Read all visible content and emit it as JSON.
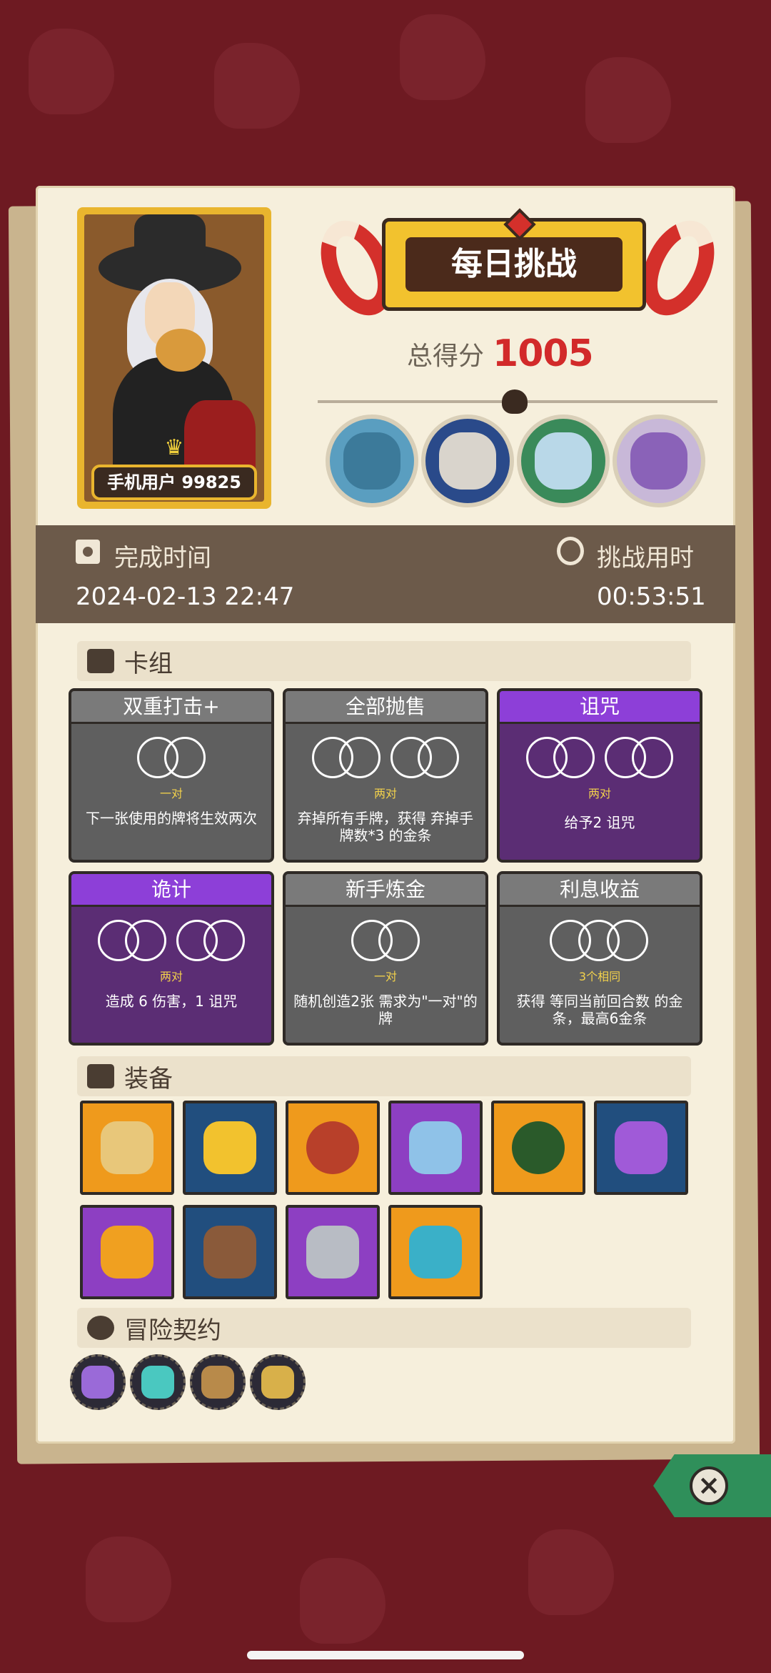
{
  "player": {
    "name": "手机用户 99825"
  },
  "challenge": {
    "title": "每日挑战",
    "score_label": "总得分",
    "score_value": "1005"
  },
  "bosses": [
    {
      "icon": "blue-ogre-boss-icon",
      "color": "#5a9ec0"
    },
    {
      "icon": "masked-woman-boss-icon",
      "color": "#d9d4cc"
    },
    {
      "icon": "hooded-child-boss-icon",
      "color": "#b9d8e8"
    },
    {
      "icon": "purple-dragon-boss-icon",
      "color": "#8a62b8"
    }
  ],
  "time": {
    "finish_label": "完成时间",
    "finish_value": "2024-02-13  22:47",
    "duration_label": "挑战用时",
    "duration_value": "00:53:51"
  },
  "sections": {
    "deck": "卡组",
    "equipment": "装备",
    "contracts": "冒险契约"
  },
  "cards": [
    {
      "title": "双重打击+",
      "color": "gray",
      "rings": "pair",
      "req": "一对",
      "desc": "下一张使用的牌将生效两次"
    },
    {
      "title": "全部抛售",
      "color": "gray",
      "rings": "two-pair",
      "req": "两对",
      "desc": "弃掉所有手牌，获得 弃掉手牌数*3 的金条"
    },
    {
      "title": "诅咒",
      "color": "purple",
      "rings": "two-pair",
      "req": "两对",
      "desc": "给予2 诅咒"
    },
    {
      "title": "诡计",
      "color": "purple",
      "rings": "two-pair",
      "req": "两对",
      "desc": "造成 6 伤害，1 诅咒"
    },
    {
      "title": "新手炼金",
      "color": "gray",
      "rings": "pair",
      "req": "一对",
      "desc": "随机创造2张 需求为\"一对\"的牌"
    },
    {
      "title": "利息收益",
      "color": "gray",
      "rings": "triple",
      "req": "3个相同",
      "desc": "获得 等同当前回合数 的金条，最高6金条"
    }
  ],
  "equipment": [
    {
      "icon": "money-sack-icon",
      "bg": "orange",
      "fill": "#e8c77a"
    },
    {
      "icon": "golden-helmet-icon",
      "bg": "blue",
      "fill": "#f2c22e"
    },
    {
      "icon": "red-plate-icon",
      "bg": "orange",
      "fill": "#b8402a"
    },
    {
      "icon": "blue-dagger-icon",
      "bg": "violet",
      "fill": "#8fc2e8"
    },
    {
      "icon": "green-horn-icon",
      "bg": "orange",
      "fill": "#2a5a2a"
    },
    {
      "icon": "purple-potion-icon",
      "bg": "blue",
      "fill": "#a05ad8"
    },
    {
      "icon": "fire-gauntlet-icon",
      "bg": "violet",
      "fill": "#f0a020"
    },
    {
      "icon": "horn-cup-icon",
      "bg": "blue",
      "fill": "#8a5a3a"
    },
    {
      "icon": "metal-cube-icon",
      "bg": "violet",
      "fill": "#b8bcc4"
    },
    {
      "icon": "flame-mask-icon",
      "bg": "orange",
      "fill": "#3ab0c8"
    }
  ],
  "contracts": [
    {
      "icon": "skull-claw-contract-icon",
      "fill": "#9a6ad8"
    },
    {
      "icon": "eye-coin-contract-icon",
      "fill": "#4ac8c0"
    },
    {
      "icon": "barrel-contract-icon",
      "fill": "#b88a4a"
    },
    {
      "icon": "lantern-contract-icon",
      "fill": "#d8b04a"
    }
  ]
}
